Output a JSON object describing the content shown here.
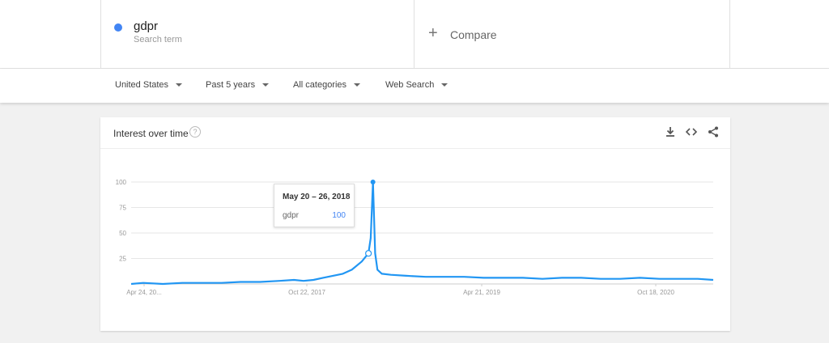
{
  "search_term": {
    "name": "gdpr",
    "subtitle": "Search term",
    "color": "#4285f4"
  },
  "compare": {
    "label": "Compare"
  },
  "filters": [
    {
      "label": "United States"
    },
    {
      "label": "Past 5 years"
    },
    {
      "label": "All categories"
    },
    {
      "label": "Web Search"
    }
  ],
  "card": {
    "title": "Interest over time",
    "help_icon": "question-icon",
    "actions": [
      "download-icon",
      "embed-icon",
      "share-icon"
    ]
  },
  "tooltip": {
    "date": "May 20 – 26, 2018",
    "term": "gdpr",
    "value": "100"
  },
  "chart_data": {
    "type": "line",
    "series": [
      {
        "name": "gdpr",
        "color": "#2196f3",
        "x": [
          "2016-04-24",
          "2016-06-01",
          "2016-08-01",
          "2016-10-01",
          "2016-12-01",
          "2017-02-01",
          "2017-04-01",
          "2017-06-01",
          "2017-08-01",
          "2017-09-15",
          "2017-10-15",
          "2017-11-15",
          "2017-12-15",
          "2018-01-15",
          "2018-02-15",
          "2018-03-15",
          "2018-04-15",
          "2018-05-06",
          "2018-05-13",
          "2018-05-20",
          "2018-05-27",
          "2018-06-03",
          "2018-06-17",
          "2018-07-15",
          "2018-09-01",
          "2018-11-01",
          "2019-01-01",
          "2019-03-01",
          "2019-05-01",
          "2019-07-01",
          "2019-09-01",
          "2019-11-01",
          "2020-01-01",
          "2020-03-01",
          "2020-05-01",
          "2020-07-01",
          "2020-09-01",
          "2020-11-01",
          "2021-01-01",
          "2021-03-01",
          "2021-04-18"
        ],
        "values": [
          0,
          1,
          0,
          1,
          1,
          1,
          2,
          2,
          3,
          4,
          3,
          4,
          6,
          8,
          10,
          14,
          22,
          30,
          45,
          100,
          30,
          14,
          10,
          9,
          8,
          7,
          7,
          7,
          6,
          6,
          6,
          5,
          6,
          6,
          5,
          5,
          6,
          5,
          5,
          5,
          4
        ]
      }
    ],
    "x_tick_labels": [
      "Apr 24, 20...",
      "Oct 22, 2017",
      "Apr 21, 2019",
      "Oct 18, 2020"
    ],
    "y_ticks": [
      25,
      50,
      75,
      100
    ],
    "ylim": [
      0,
      100
    ],
    "grid": true
  }
}
